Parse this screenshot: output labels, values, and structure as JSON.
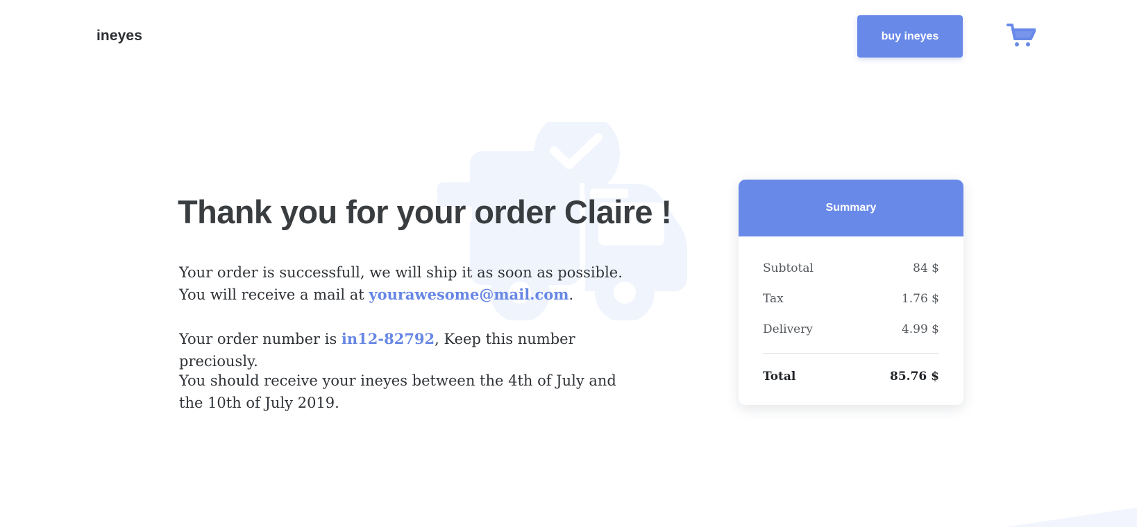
{
  "brand": {
    "name": "ineyes",
    "accent_color": "#6889e8"
  },
  "header": {
    "buy_button_label": "buy ineyes",
    "cart_icon": "shopping-cart-icon"
  },
  "hero": {
    "background_icon": "truck-check-icon",
    "title": "Thank you for your order Claire !"
  },
  "content": {
    "line_1": "Your order is successfull, we will ship it as soon as possible.",
    "line_2_prefix": "You will receive a mail at ",
    "email": "yourawesome@mail.com",
    "line_2_suffix": ".",
    "order_prefix": "Your order number is ",
    "order_number": "in12-82792",
    "order_suffix": ", Keep this number preciously.",
    "delivery_line": "You should receive your ineyes between the 4th of July and the 10th of July 2019."
  },
  "summary": {
    "title": "Summary",
    "rows": [
      {
        "label": "Subtotal",
        "value": "84 $"
      },
      {
        "label": "Tax",
        "value": "1.76 $"
      },
      {
        "label": "Delivery",
        "value": "4.99 $"
      }
    ],
    "total_label": "Total",
    "total_value": "85.76 $"
  }
}
